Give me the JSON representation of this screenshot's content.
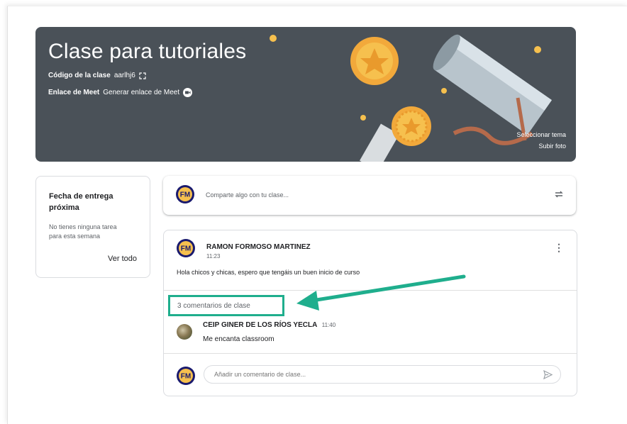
{
  "banner": {
    "title": "Clase para tutoriales",
    "code_label": "Código de la clase",
    "code_value": "aarlhj6",
    "meet_label": "Enlace de Meet",
    "meet_value": "Generar enlace de Meet",
    "select_theme": "Seleccionar tema",
    "upload_photo": "Subir foto"
  },
  "upcoming": {
    "title": "Fecha de entrega próxima",
    "text": "No tienes ninguna tarea para esta semana",
    "view_all": "Ver todo"
  },
  "share": {
    "placeholder": "Comparte algo con tu clase..."
  },
  "post": {
    "author": "RAMON FORMOSO MARTINEZ",
    "time": "11:23",
    "message": "Hola chicos y chicas, espero que tengáis un buen inicio de curso",
    "comments_count": "3 comentarios de clase",
    "comment": {
      "author": "CEIP GINER DE LOS RÍOS YECLA",
      "time": "11:40",
      "text": "Me encanta classroom"
    },
    "comment_placeholder": "Añadir un comentario de clase..."
  },
  "colors": {
    "banner_bg": "#4a5158",
    "highlight": "#1fae8d",
    "avatar_bg": "#1a1a6e"
  },
  "icons": [
    "fullscreen-icon",
    "meet-icon",
    "repost-icon",
    "more-vert-icon",
    "send-icon",
    "annotation-arrow"
  ]
}
